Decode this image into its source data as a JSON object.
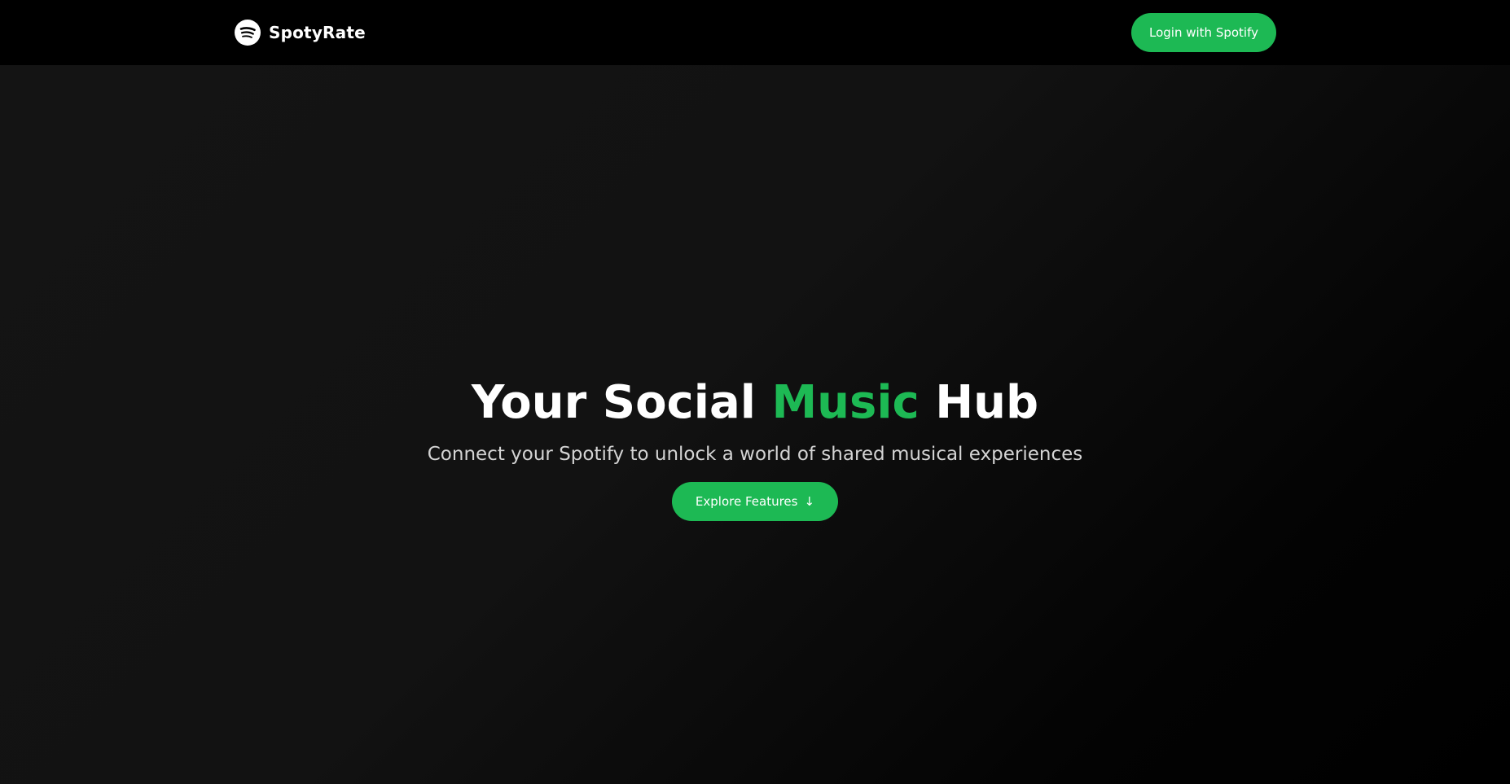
{
  "navbar": {
    "brand_name": "SpotyRate",
    "brand_icon": "spotify-logo-icon",
    "login_label": "Login with Spotify"
  },
  "hero": {
    "title_part1": "Your Social ",
    "title_accent": "Music",
    "title_part2": " Hub",
    "subtitle": "Connect your Spotify to unlock a world of shared musical experiences",
    "cta_label": "Explore Features",
    "cta_icon": "arrow-down-icon",
    "cta_icon_glyph": "↓"
  },
  "colors": {
    "accent": "#1db954",
    "nav_background": "#000000",
    "page_background": "#121212",
    "text_primary": "#ffffff",
    "text_secondary": "#d4d4d4"
  }
}
